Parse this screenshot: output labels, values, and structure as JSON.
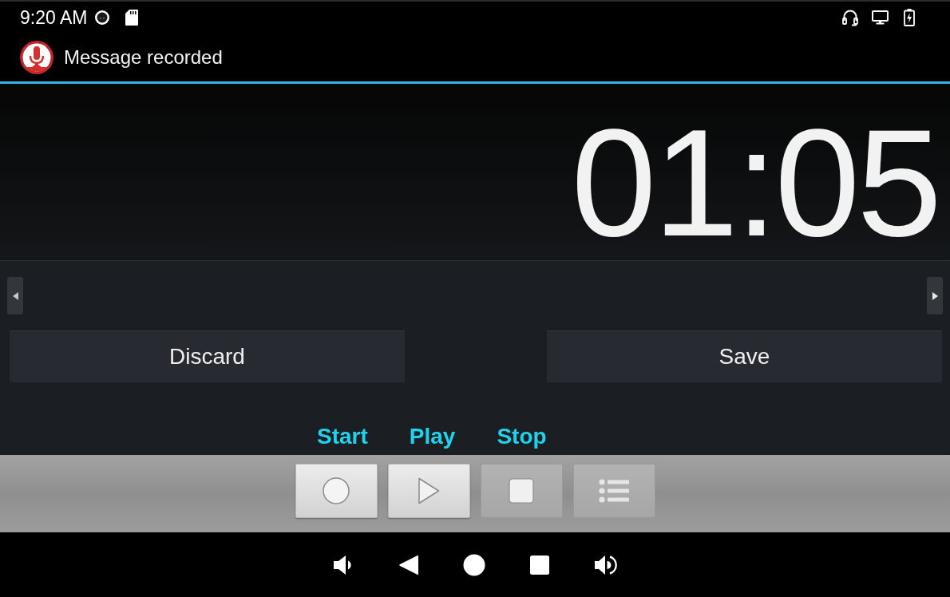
{
  "status_bar": {
    "time": "9:20 AM"
  },
  "notification": {
    "title": "Message recorded"
  },
  "timer": {
    "reading": "01:05"
  },
  "actions": [
    {
      "label": "Discard"
    },
    {
      "label": "Save"
    }
  ],
  "control_labels": [
    {
      "label": "Start"
    },
    {
      "label": "Play"
    },
    {
      "label": "Stop"
    }
  ],
  "toolbar": [
    {
      "kind": "record",
      "disabled": false
    },
    {
      "kind": "play",
      "disabled": false
    },
    {
      "kind": "stop",
      "disabled": true
    },
    {
      "kind": "list",
      "disabled": true
    }
  ]
}
